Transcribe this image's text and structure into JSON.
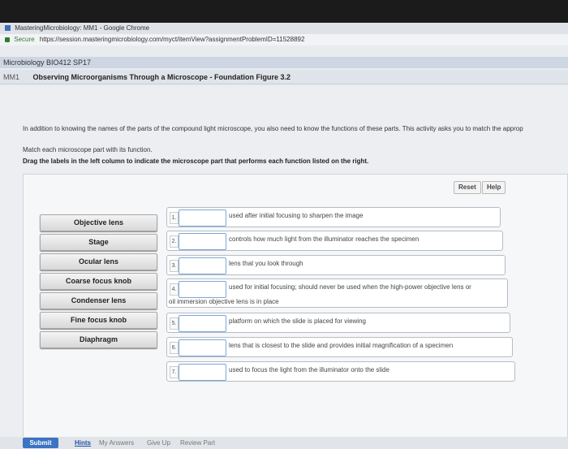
{
  "browser": {
    "window_title": "MasteringMicrobiology: MM1 - Google Chrome",
    "secure_label": "Secure",
    "url": "https://session.masteringmicrobiology.com/myct/itemView?assignmentProblemID=11528892"
  },
  "course": {
    "name": "Microbiology BIO412 SP17"
  },
  "breadcrumb": {
    "code": "MM1",
    "title": "Observing Microorganisms Through a Microscope - Foundation Figure 3.2"
  },
  "instructions": {
    "intro": "In addition to knowing the names of the parts of the compound light microscope, you also need to know the functions of these parts. This activity asks you to match the approp",
    "match": "Match each microscope part with its function.",
    "drag": "Drag the labels in the left column to indicate the microscope part that performs each function listed on the right."
  },
  "toolbar": {
    "reset": "Reset",
    "help": "Help"
  },
  "labels": [
    "Objective lens",
    "Stage",
    "Ocular lens",
    "Coarse focus knob",
    "Condenser lens",
    "Fine focus knob",
    "Diaphragm"
  ],
  "targets": [
    {
      "num": "1.",
      "text": "used after initial focusing to sharpen the image"
    },
    {
      "num": "2.",
      "text": "controls how much light from the illuminator reaches the specimen"
    },
    {
      "num": "3.",
      "text": "lens that you look through"
    },
    {
      "num": "4.",
      "text": "used for initial focusing; should never be used when the high-power objective lens or",
      "text2": "oil immersion objective lens is in place"
    },
    {
      "num": "5.",
      "text": "platform on which the slide is placed for viewing"
    },
    {
      "num": "6.",
      "text": "lens that is closest to the slide and provides initial magnification of a specimen"
    },
    {
      "num": "7.",
      "text": "used to focus the light from the illuminator onto the slide"
    }
  ],
  "footer": {
    "submit": "Submit",
    "hints": "Hints",
    "my_answers": "My Answers",
    "give_up": "Give Up",
    "review_part": "Review Part"
  }
}
